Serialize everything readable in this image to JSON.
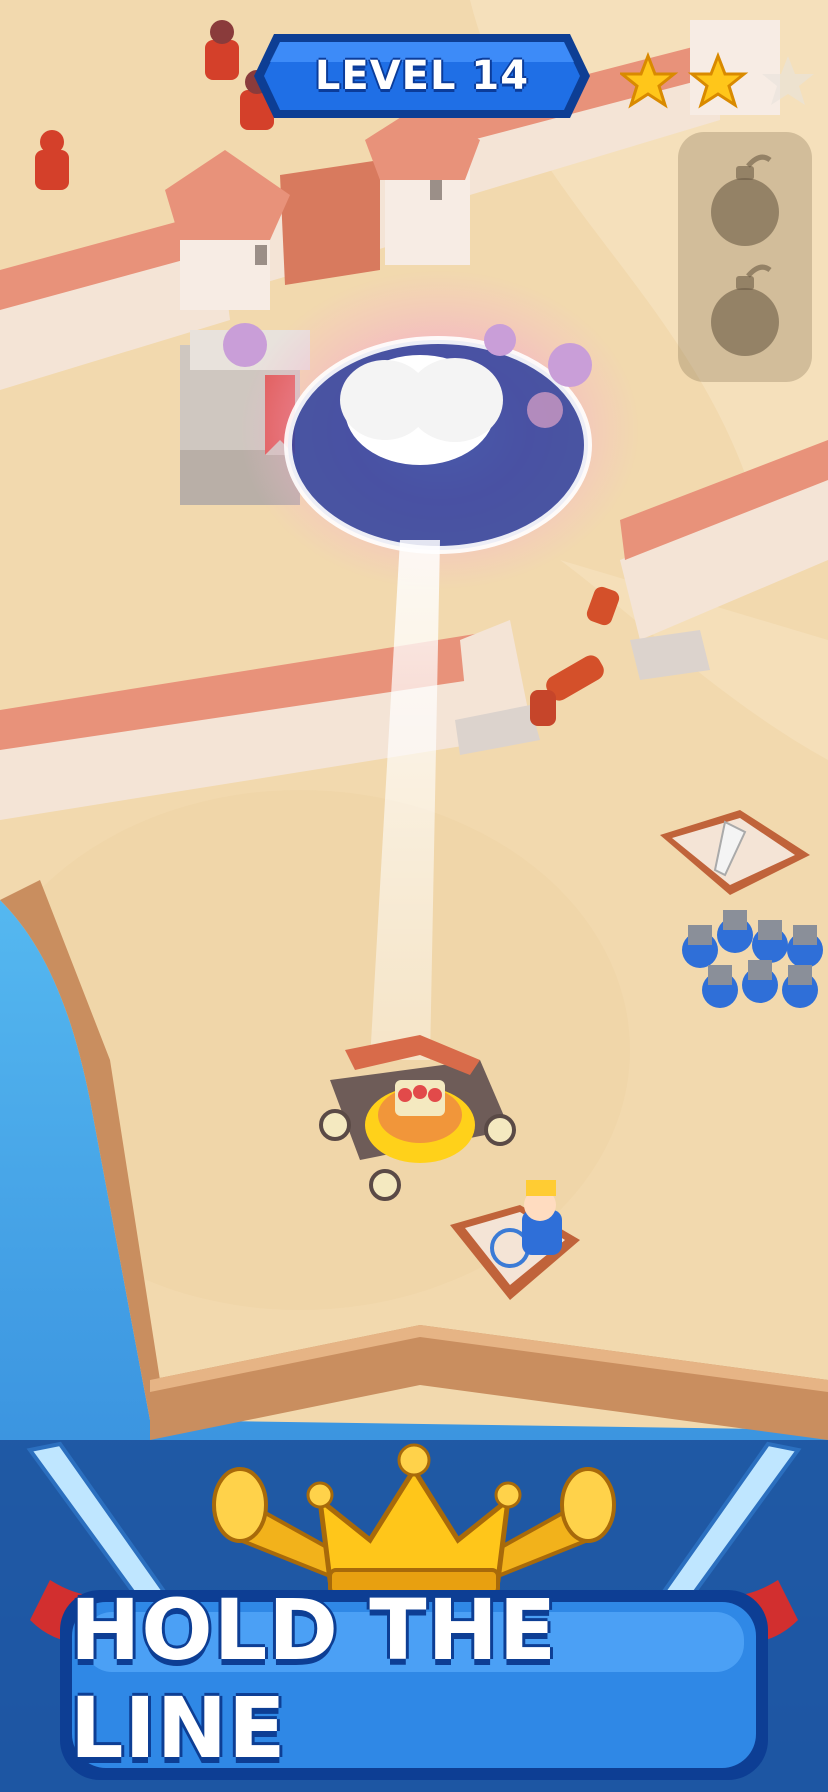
{
  "hud": {
    "level_label": "LEVEL 14",
    "stars_earned": 2,
    "stars_total": 3,
    "bombs_remaining": 2
  },
  "banner": {
    "title": "HOLD THE LINE"
  },
  "icons": {
    "star": "star-icon",
    "bomb": "bomb-icon",
    "crown": "crown-icon",
    "sword": "sword-icon",
    "trumpet": "trumpet-icon"
  },
  "colors": {
    "sand": "#f3dcb2",
    "water": "#3a9fe0",
    "badge_blue": "#1f6fe6",
    "star_gold": "#ffc61a",
    "wall_roof": "#e8927a",
    "enemy_red": "#d4402a",
    "ally_blue": "#2f6fd8"
  }
}
